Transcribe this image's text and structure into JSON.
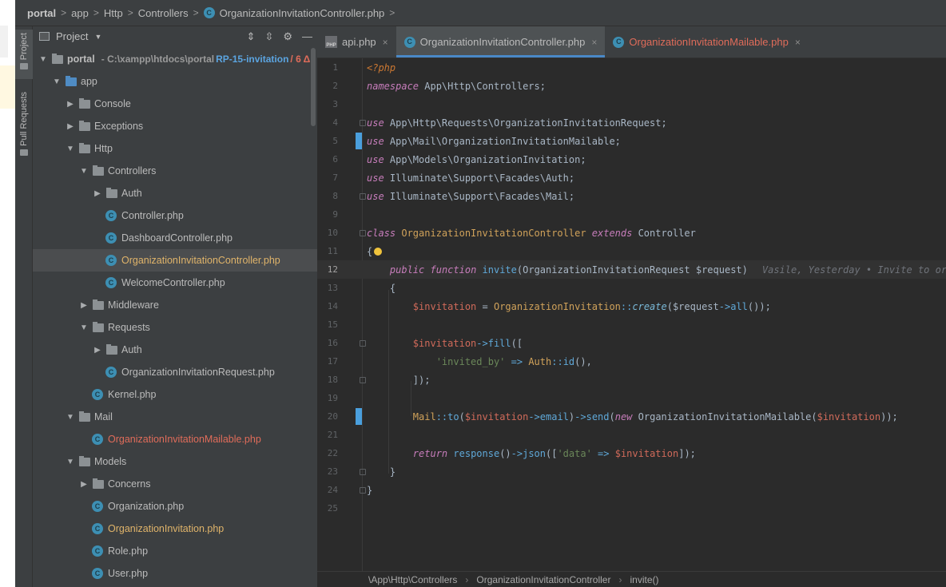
{
  "breadcrumb": [
    {
      "label": "portal",
      "strong": true
    },
    {
      "label": "app"
    },
    {
      "label": "Http"
    },
    {
      "label": "Controllers"
    },
    {
      "label": "OrganizationInvitationController.php",
      "file": true
    }
  ],
  "toolstrip": {
    "project_label": "Project",
    "pull_requests_label": "Pull Requests"
  },
  "project_panel": {
    "title": "Project",
    "tree": [
      {
        "label": "portal",
        "indent": 0,
        "arrow": "open",
        "type": "folder",
        "root": true,
        "path": "- C:\\xampp\\htdocs\\portal",
        "branch": "RP-15-invitation",
        "changes": "/ 6 Δ"
      },
      {
        "label": "app",
        "indent": 1,
        "arrow": "open",
        "type": "folder-blue"
      },
      {
        "label": "Console",
        "indent": 2,
        "arrow": "closed",
        "type": "folder"
      },
      {
        "label": "Exceptions",
        "indent": 2,
        "arrow": "closed",
        "type": "folder"
      },
      {
        "label": "Http",
        "indent": 2,
        "arrow": "open",
        "type": "folder"
      },
      {
        "label": "Controllers",
        "indent": 3,
        "arrow": "open",
        "type": "folder"
      },
      {
        "label": "Auth",
        "indent": 4,
        "arrow": "closed",
        "type": "folder"
      },
      {
        "label": "Controller.php",
        "indent": 5,
        "type": "class"
      },
      {
        "label": "DashboardController.php",
        "indent": 5,
        "type": "class"
      },
      {
        "label": "OrganizationInvitationController.php",
        "indent": 5,
        "type": "class",
        "state": "added",
        "selected": true
      },
      {
        "label": "WelcomeController.php",
        "indent": 5,
        "type": "class"
      },
      {
        "label": "Middleware",
        "indent": 3,
        "arrow": "closed",
        "type": "folder"
      },
      {
        "label": "Requests",
        "indent": 3,
        "arrow": "open",
        "type": "folder"
      },
      {
        "label": "Auth",
        "indent": 4,
        "arrow": "closed",
        "type": "folder"
      },
      {
        "label": "OrganizationInvitationRequest.php",
        "indent": 5,
        "type": "class"
      },
      {
        "label": "Kernel.php",
        "indent": 4,
        "type": "class"
      },
      {
        "label": "Mail",
        "indent": 2,
        "arrow": "open",
        "type": "folder"
      },
      {
        "label": "OrganizationInvitationMailable.php",
        "indent": 4,
        "type": "class",
        "state": "modified"
      },
      {
        "label": "Models",
        "indent": 2,
        "arrow": "open",
        "type": "folder"
      },
      {
        "label": "Concerns",
        "indent": 3,
        "arrow": "closed",
        "type": "folder"
      },
      {
        "label": "Organization.php",
        "indent": 4,
        "type": "class"
      },
      {
        "label": "OrganizationInvitation.php",
        "indent": 4,
        "type": "class",
        "state": "added"
      },
      {
        "label": "Role.php",
        "indent": 4,
        "type": "class"
      },
      {
        "label": "User.php",
        "indent": 4,
        "type": "class"
      }
    ]
  },
  "editor_tabs": [
    {
      "label": "api.php",
      "icon": "php-file-icon",
      "active": false
    },
    {
      "label": "OrganizationInvitationController.php",
      "icon": "class-icon",
      "active": true
    },
    {
      "label": "OrganizationInvitationMailable.php",
      "icon": "class-icon",
      "active": false,
      "state": "modified"
    }
  ],
  "code": {
    "current_line": 12,
    "lines": [
      {
        "n": "1",
        "html": "<span class='k'>&lt;?php</span>"
      },
      {
        "n": "2",
        "html": "<span class='ki'>namespace</span> App\\Http\\Controllers;"
      },
      {
        "n": "3",
        "html": ""
      },
      {
        "n": "4",
        "html": "<span class='ki'>use</span> App\\Http\\Requests\\OrganizationInvitationRequest;",
        "fold": true
      },
      {
        "n": "5",
        "html": "<span class='ki'>use</span> App\\Mail\\OrganizationInvitationMailable;",
        "change": true
      },
      {
        "n": "6",
        "html": "<span class='ki'>use</span> App\\Models\\OrganizationInvitation;"
      },
      {
        "n": "7",
        "html": "<span class='ki'>use</span> Illuminate\\Support\\Facades\\Auth;"
      },
      {
        "n": "8",
        "html": "<span class='ki'>use</span> Illuminate\\Support\\Facades\\Mail;",
        "fold": true
      },
      {
        "n": "9",
        "html": ""
      },
      {
        "n": "10",
        "html": "<span class='ki'>class</span> <span class='mstat'>OrganizationInvitationController</span> <span class='ki'>extends</span> Controller",
        "fold": true
      },
      {
        "n": "11",
        "html": "{<span class='bulb'></span>"
      },
      {
        "n": "12",
        "html": "    <span class='ki'>public</span> <span class='ki'>function</span> <span class='m'>invite</span>(OrganizationInvitationRequest $request)"
      },
      {
        "n": "13",
        "html": "    {"
      },
      {
        "n": "14",
        "html": "        <span class='v'>$invitation</span> = <span class='mstat'>OrganizationInvitation</span><span class='op'>::</span><span class='pb'>create</span>($request<span class='op'>-&gt;</span><span class='m'>all</span>());"
      },
      {
        "n": "15",
        "html": ""
      },
      {
        "n": "16",
        "html": "        <span class='v'>$invitation</span><span class='op'>-&gt;</span><span class='m'>fill</span>([",
        "fold": true
      },
      {
        "n": "17",
        "html": "            <span class='s'>'invited_by'</span> <span class='op'>=&gt;</span> <span class='mstat'>Auth</span><span class='op'>::</span><span class='m'>id</span>(),"
      },
      {
        "n": "18",
        "html": "        ]);",
        "fold": true
      },
      {
        "n": "19",
        "html": ""
      },
      {
        "n": "20",
        "html": "        <span class='mstat'>Mail</span><span class='op'>::</span><span class='m'>to</span>(<span class='v'>$invitation</span><span class='op'>-&gt;</span><span class='m'>email</span>)<span class='op'>-&gt;</span><span class='m'>send</span>(<span class='ki'>new</span> OrganizationInvitationMailable(<span class='v'>$invitation</span>));",
        "change": true
      },
      {
        "n": "21",
        "html": ""
      },
      {
        "n": "22",
        "html": "        <span class='ki'>return</span> <span class='m'>response</span>()<span class='op'>-&gt;</span><span class='m'>json</span>([<span class='s'>'data'</span> <span class='op'>=&gt;</span> <span class='v'>$invitation</span>]);"
      },
      {
        "n": "23",
        "html": "    }",
        "fold": true
      },
      {
        "n": "24",
        "html": "}",
        "fold": true
      },
      {
        "n": "25",
        "html": ""
      }
    ],
    "lens_text": "Vasile, Yesterday • Invite to organ"
  },
  "status_breadcrumb": [
    "\\App\\Http\\Controllers",
    "OrganizationInvitationController",
    "invite()"
  ]
}
